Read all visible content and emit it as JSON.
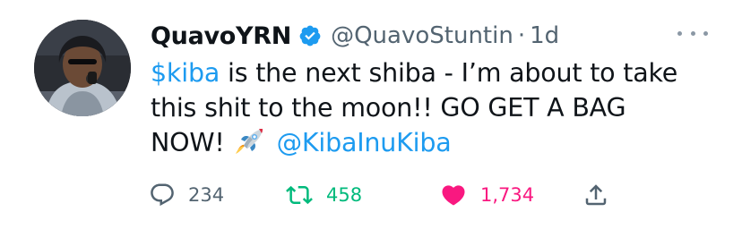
{
  "user": {
    "display_name": "QuavoYRN",
    "handle": "@QuavoStuntin",
    "time": "1d",
    "separator": "·"
  },
  "tweet": {
    "line1_cashtag": "$kiba",
    "line1_rest": " is the next shiba - I’m about to take",
    "line2": "this shit to the moon!! GO GET A BAG",
    "line3_text": "NOW!",
    "line3_mention": "@KibaInuKiba"
  },
  "actions": {
    "reply_count": "234",
    "retweet_count": "458",
    "like_count": "1,734"
  },
  "icons": {
    "verified": "verified-badge-icon",
    "more": "more-options-icon",
    "rocket": "rocket-emoji-icon",
    "reply": "reply-icon",
    "retweet": "retweet-icon",
    "like": "heart-icon",
    "share": "share-icon"
  },
  "colors": {
    "link": "#1d9bf0",
    "retweet": "#00ba7c",
    "like": "#f91880",
    "muted": "#536471"
  }
}
